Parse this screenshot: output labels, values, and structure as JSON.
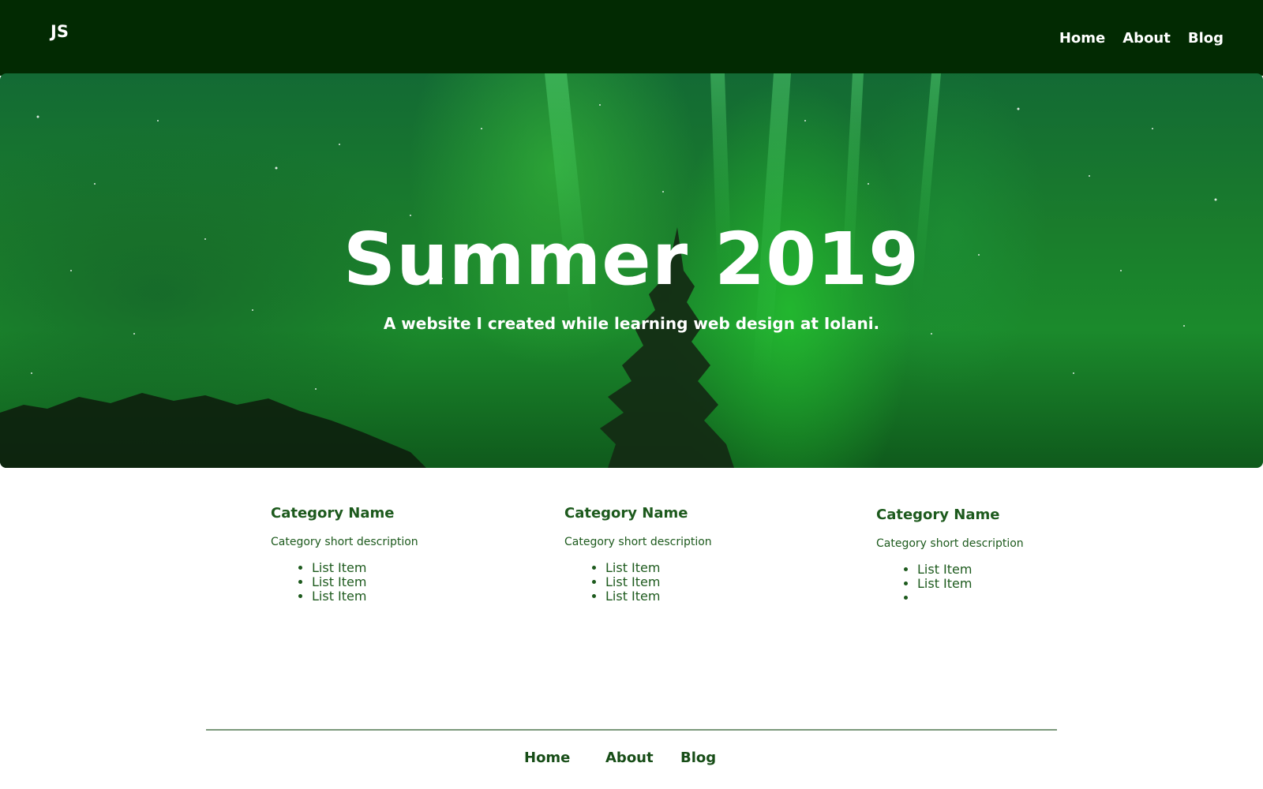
{
  "header": {
    "logo": "JS",
    "nav": [
      "Home",
      "About",
      "Blog"
    ]
  },
  "hero": {
    "title": "Summer 2019",
    "subtitle": "A website I created while learning web design at Iolani."
  },
  "categories": [
    {
      "name": "Category Name",
      "description": "Category short description",
      "items": [
        "List Item",
        "List Item",
        "List Item"
      ]
    },
    {
      "name": "Category Name",
      "description": "Category short description",
      "items": [
        "List Item",
        "List Item",
        "List Item"
      ]
    },
    {
      "name": "Category Name",
      "description": "Category short description",
      "items": [
        "List Item",
        "List Item",
        ""
      ]
    }
  ],
  "footer": {
    "nav": [
      "Home",
      "About",
      "Blog"
    ]
  },
  "colors": {
    "header_bg": "#022a02",
    "accent": "#1d5a1d",
    "footer_rule": "#7b997b"
  }
}
